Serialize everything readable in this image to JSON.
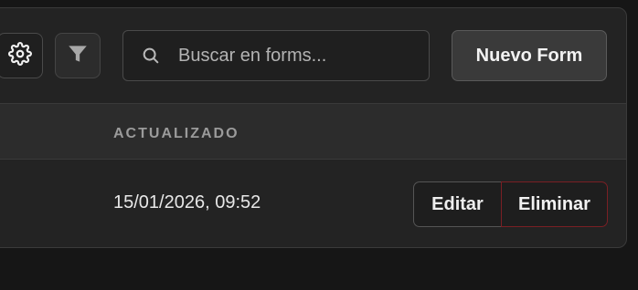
{
  "toolbar": {
    "settings_icon": "gear-icon",
    "filter_icon": "funnel-icon",
    "search": {
      "icon": "search-icon",
      "placeholder": "Buscar en forms..."
    },
    "new_button_label": "Nuevo Form"
  },
  "table": {
    "columns": [
      "ACTUALIZADO"
    ],
    "rows": [
      {
        "updated": "15/01/2026, 09:52",
        "edit_label": "Editar",
        "delete_label": "Eliminar"
      }
    ]
  },
  "colors": {
    "background": "#161616",
    "panel": "#232323",
    "header": "#2c2c2c",
    "danger_border": "#7a1f24"
  }
}
